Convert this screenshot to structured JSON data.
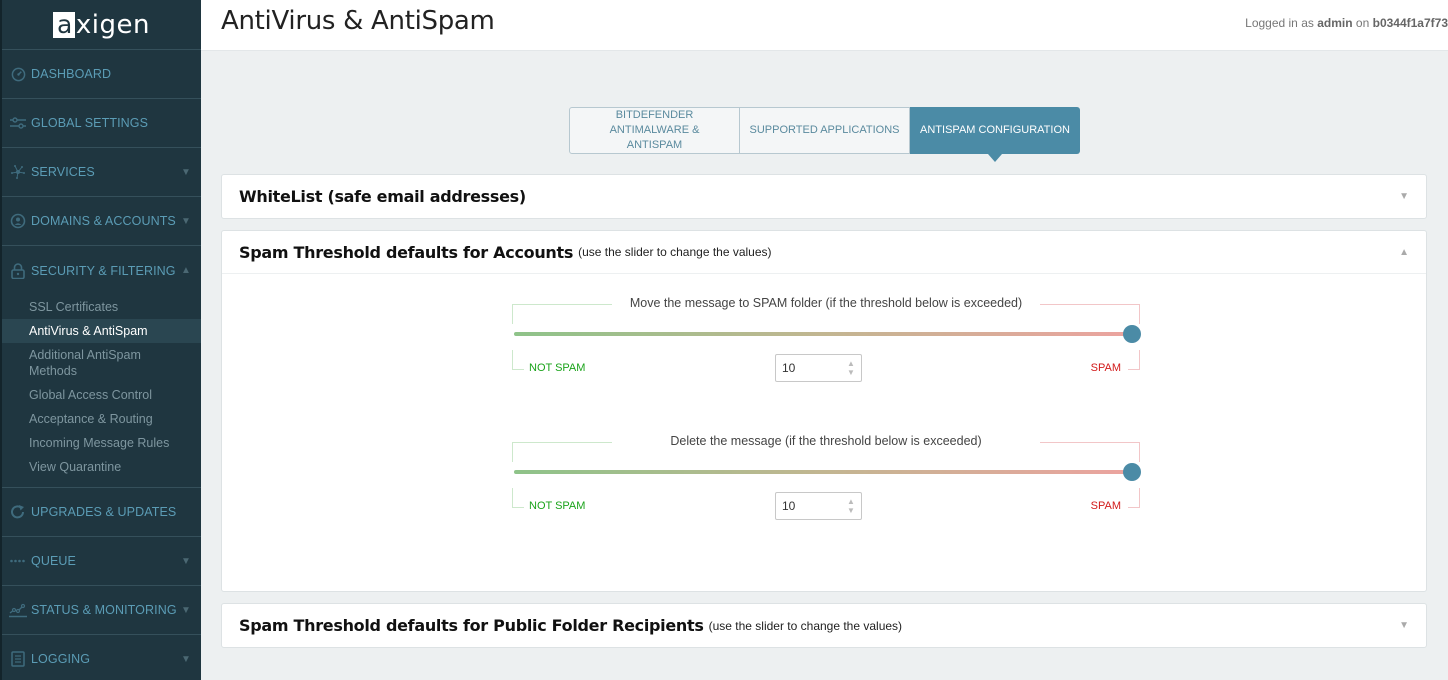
{
  "logo": {
    "text_a": "a",
    "text_rest": "xigen"
  },
  "header": {
    "title": "AntiVirus & AntiSpam",
    "login_prefix": "Logged in as",
    "login_user": "admin",
    "login_on": "on",
    "login_host": "b0344f1a7f73"
  },
  "sidebar": {
    "items": [
      {
        "label": "DASHBOARD",
        "icon": "dashboard-icon",
        "arrow": ""
      },
      {
        "label": "GLOBAL SETTINGS",
        "icon": "sliders-icon",
        "arrow": ""
      },
      {
        "label": "SERVICES",
        "icon": "network-icon",
        "arrow": "▼"
      },
      {
        "label": "DOMAINS & ACCOUNTS",
        "icon": "user-circle-icon",
        "arrow": "▼"
      },
      {
        "label": "SECURITY & FILTERING",
        "icon": "lock-icon",
        "arrow": "▲"
      },
      {
        "label": "UPGRADES & UPDATES",
        "icon": "refresh-icon",
        "arrow": ""
      },
      {
        "label": "QUEUE",
        "icon": "queue-dots-icon",
        "arrow": "▼"
      },
      {
        "label": "STATUS & MONITORING",
        "icon": "chart-line-icon",
        "arrow": "▼"
      },
      {
        "label": "LOGGING",
        "icon": "document-icon",
        "arrow": "▼"
      }
    ],
    "security_sub": [
      {
        "label": "SSL Certificates",
        "active": false
      },
      {
        "label": "AntiVirus & AntiSpam",
        "active": true
      },
      {
        "label": "Additional AntiSpam Methods",
        "active": false
      },
      {
        "label": "Global Access Control",
        "active": false
      },
      {
        "label": "Acceptance & Routing",
        "active": false
      },
      {
        "label": "Incoming Message Rules",
        "active": false
      },
      {
        "label": "View Quarantine",
        "active": false
      }
    ]
  },
  "tabs": [
    {
      "label": "BITDEFENDER ANTIMALWARE & ANTISPAM",
      "active": false
    },
    {
      "label": "SUPPORTED APPLICATIONS",
      "active": false
    },
    {
      "label": "ANTISPAM CONFIGURATION",
      "active": true
    }
  ],
  "panels": {
    "whitelist": {
      "title": "WhiteList (safe email addresses)",
      "toggle": "▼"
    },
    "accounts": {
      "title": "Spam Threshold defaults for Accounts",
      "subtitle": "(use the slider to change the values)",
      "toggle": "▲",
      "sliders": [
        {
          "caption": "Move the message to SPAM folder (if the threshold below is exceeded)",
          "value": "10",
          "position_fraction": 1.0,
          "low_label": "NOT SPAM",
          "high_label": "SPAM"
        },
        {
          "caption": "Delete the message (if the threshold below is exceeded)",
          "value": "10",
          "position_fraction": 1.0,
          "low_label": "NOT SPAM",
          "high_label": "SPAM"
        }
      ]
    },
    "public": {
      "title": "Spam Threshold defaults for Public Folder Recipients",
      "subtitle": "(use the slider to change the values)",
      "toggle": "▼"
    }
  },
  "colors": {
    "accent": "#4b8ba6",
    "sidebar_bg": "#1f3640",
    "not_spam": "#1aa31a",
    "spam": "#d21a1a"
  }
}
